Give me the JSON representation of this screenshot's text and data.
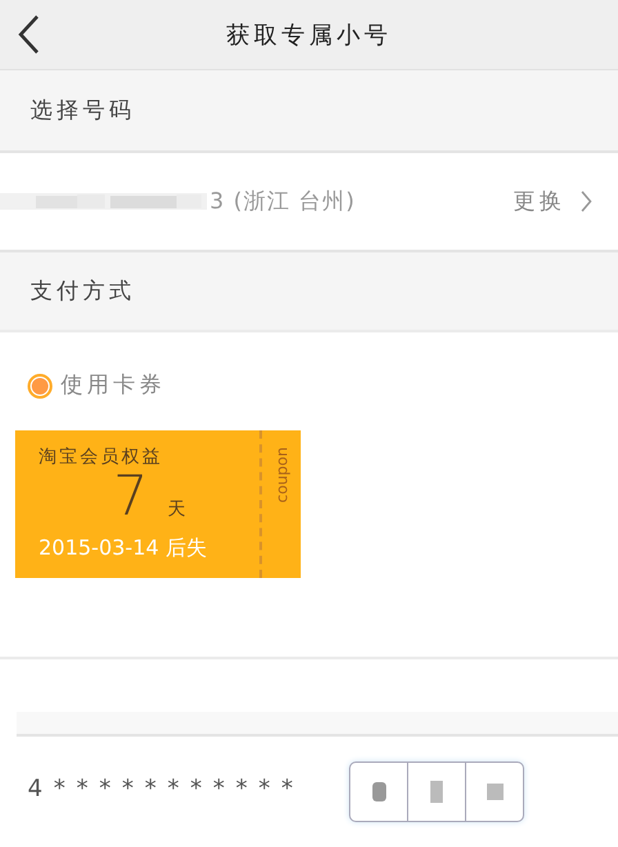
{
  "header": {
    "title": "获取专属小号"
  },
  "number_section": {
    "heading": "选择号码",
    "number": "3 (浙江 台州)",
    "change": "更换"
  },
  "payment_section": {
    "heading": "支付方式"
  },
  "options": [
    {
      "label": "使用卡券",
      "selected": true
    }
  ],
  "coupon": {
    "title": "淘宝会员权益",
    "amount": "7",
    "unit": "天",
    "expiry": "2015-03-14 后失",
    "side_label": "coupon"
  },
  "masked_number": "4***********"
}
